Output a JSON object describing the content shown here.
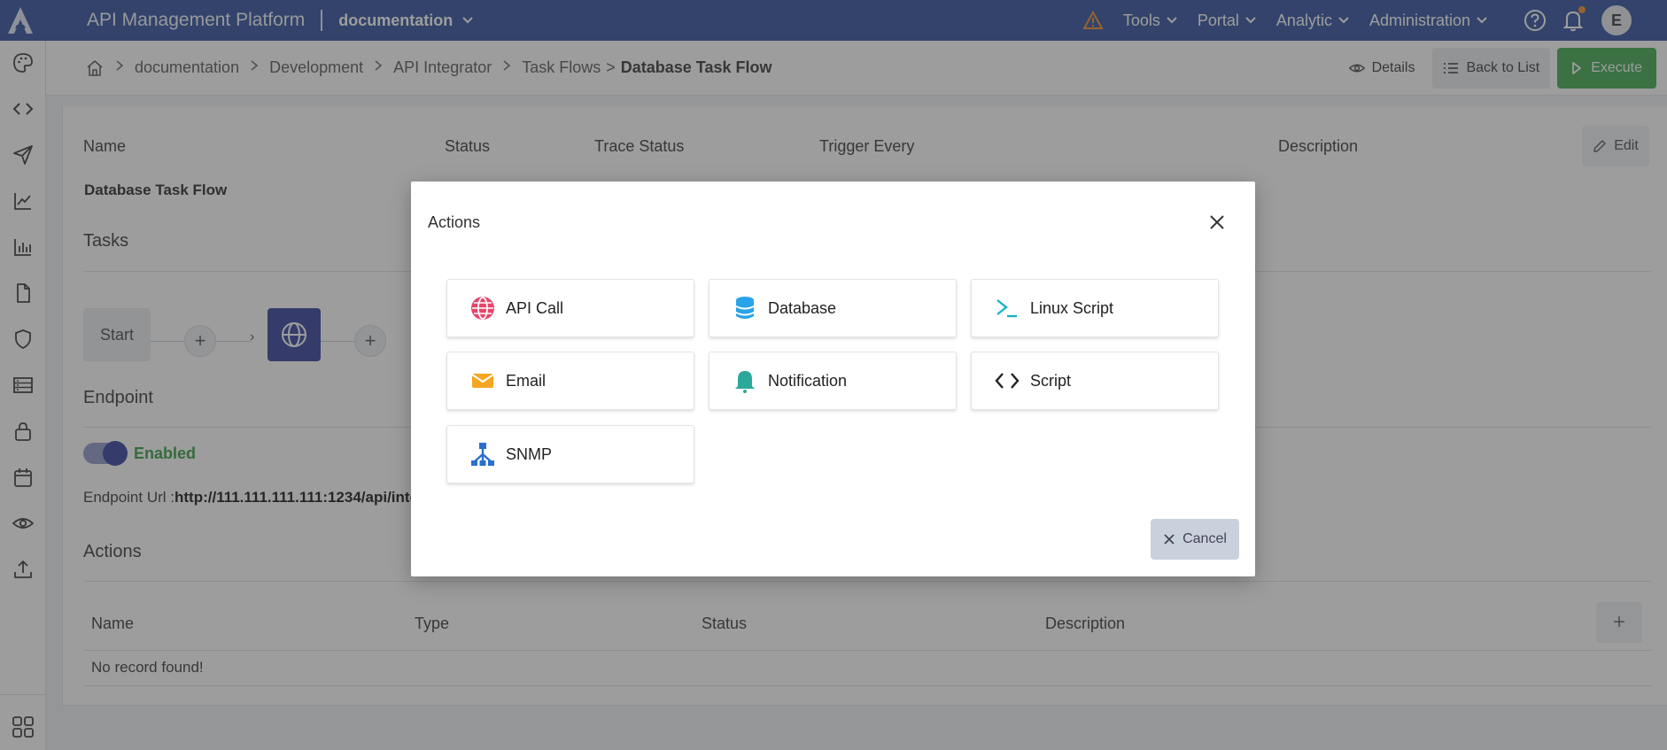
{
  "header": {
    "app_title": "API Management Platform",
    "project": "documentation",
    "menus": [
      "Tools",
      "Portal",
      "Analytic",
      "Administration"
    ],
    "avatar_initial": "E"
  },
  "breadcrumb": {
    "items": [
      "documentation",
      "Development",
      "API Integrator"
    ],
    "task_flows": "Task Flows",
    "separator_gt": ">",
    "current": "Database Task Flow",
    "details_label": "Details",
    "back_label": "Back to List",
    "execute_label": "Execute"
  },
  "detail": {
    "columns": {
      "name": "Name",
      "status": "Status",
      "trace_status": "Trace Status",
      "trigger_every": "Trigger Every",
      "description": "Description"
    },
    "name_value": "Database Task Flow",
    "edit_label": "Edit"
  },
  "tasks": {
    "title": "Tasks",
    "start_label": "Start"
  },
  "endpoint": {
    "title": "Endpoint",
    "toggle_label": "Enabled",
    "url_label": "Endpoint Url :",
    "url_value": "http://111.111.111.111:1234/api/inte"
  },
  "actions_table": {
    "title": "Actions",
    "columns": [
      "Name",
      "Type",
      "Status",
      "Description"
    ],
    "empty_text": "No record found!"
  },
  "modal": {
    "title": "Actions",
    "cancel_label": "Cancel",
    "options": [
      {
        "label": "API Call",
        "icon": "api-call-icon"
      },
      {
        "label": "Database",
        "icon": "database-icon"
      },
      {
        "label": "Linux Script",
        "icon": "terminal-icon"
      },
      {
        "label": "Email",
        "icon": "email-icon"
      },
      {
        "label": "Notification",
        "icon": "bell-icon"
      },
      {
        "label": "Script",
        "icon": "code-icon"
      },
      {
        "label": "SNMP",
        "icon": "snmp-icon"
      }
    ]
  },
  "colors": {
    "header_bg": "#2a4a9a",
    "execute_green": "#3aa64a",
    "enabled_green": "#2f9a3f",
    "node_blue": "#2f3d9a",
    "warning_orange": "#f08a24"
  }
}
